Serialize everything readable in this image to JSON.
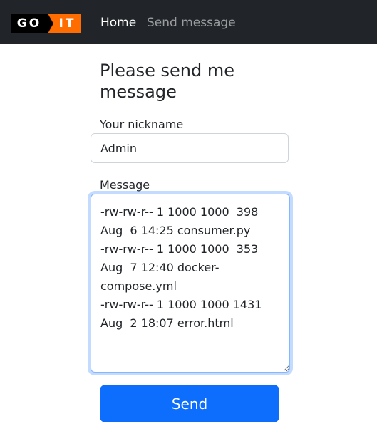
{
  "navbar": {
    "logo_left": "GO",
    "logo_right": "IT",
    "links": [
      {
        "label": "Home"
      },
      {
        "label": "Send message"
      }
    ]
  },
  "form": {
    "title": "Please send me message",
    "nickname_label": "Your nickname",
    "nickname_value": "Admin",
    "message_label": "Message",
    "message_value": "-rw-rw-r-- 1 1000 1000  398 Aug  6 14:25 consumer.py\n-rw-rw-r-- 1 1000 1000  353 Aug  7 12:40 docker-compose.yml\n-rw-rw-r-- 1 1000 1000 1431 Aug  2 18:07 error.html",
    "send_label": "Send"
  },
  "colors": {
    "navbar_bg": "#212529",
    "logo_orange": "#ff6c00",
    "primary": "#0d6efd"
  }
}
